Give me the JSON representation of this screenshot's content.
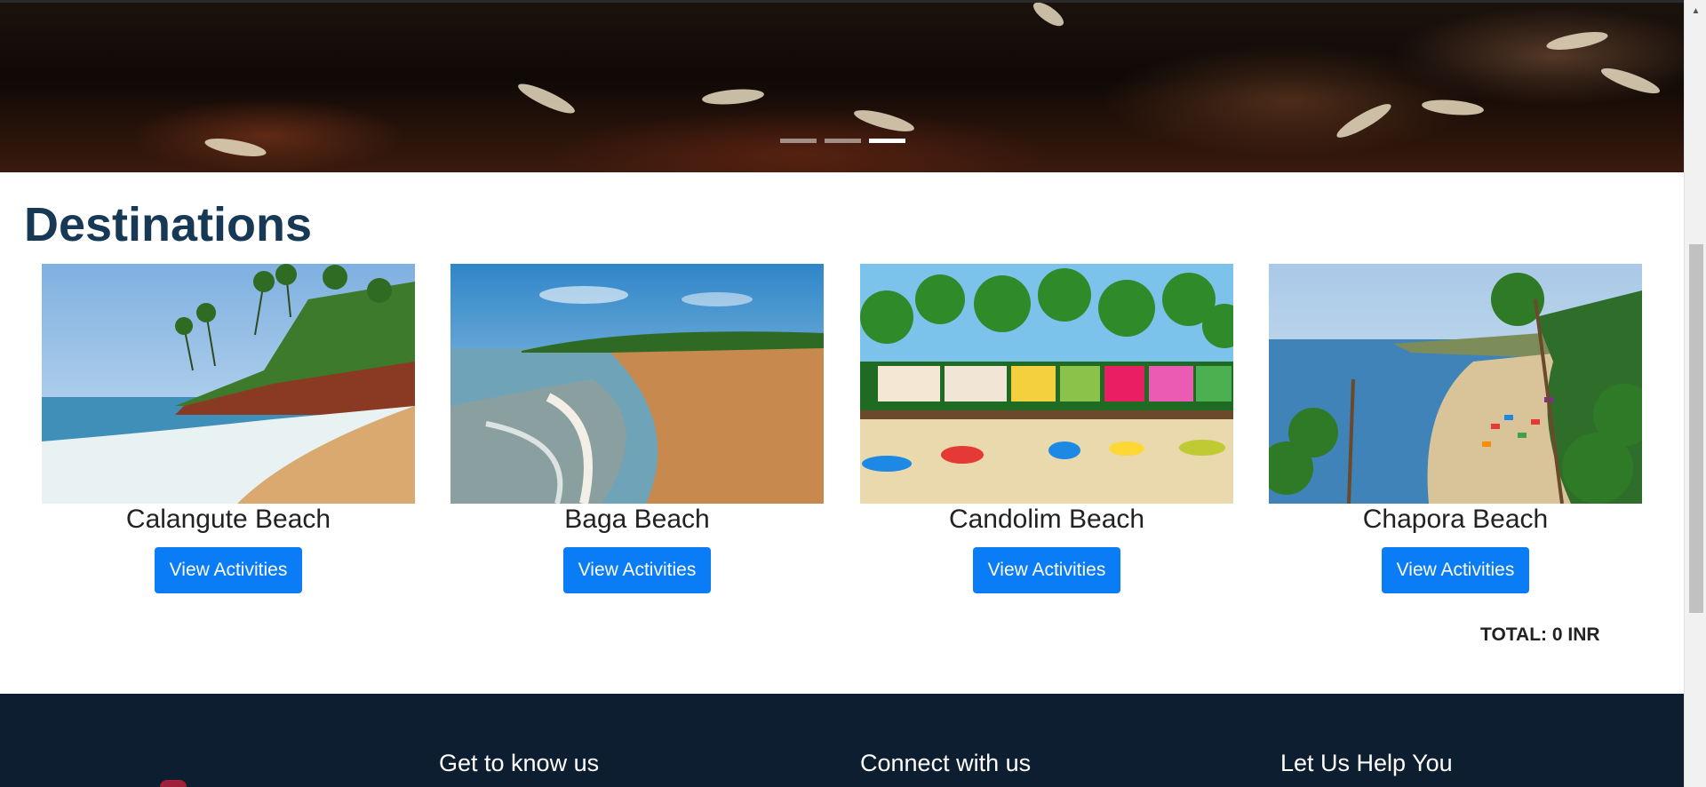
{
  "hero": {
    "slides": [
      {
        "active": false
      },
      {
        "active": false
      },
      {
        "active": true
      }
    ]
  },
  "destinations": {
    "heading": "Destinations",
    "items": [
      {
        "name": "Calangute Beach",
        "button": "View Activities"
      },
      {
        "name": "Baga Beach",
        "button": "View Activities"
      },
      {
        "name": "Candolim Beach",
        "button": "View Activities"
      },
      {
        "name": "Chapora Beach",
        "button": "View Activities"
      }
    ],
    "total_label": "TOTAL: 0 INR"
  },
  "footer": {
    "columns": [
      "Get to know us",
      "Connect with us",
      "Let Us Help You"
    ]
  },
  "colors": {
    "heading": "#183955",
    "button": "#0a7cf5",
    "footer_bg": "#0e1e31"
  }
}
